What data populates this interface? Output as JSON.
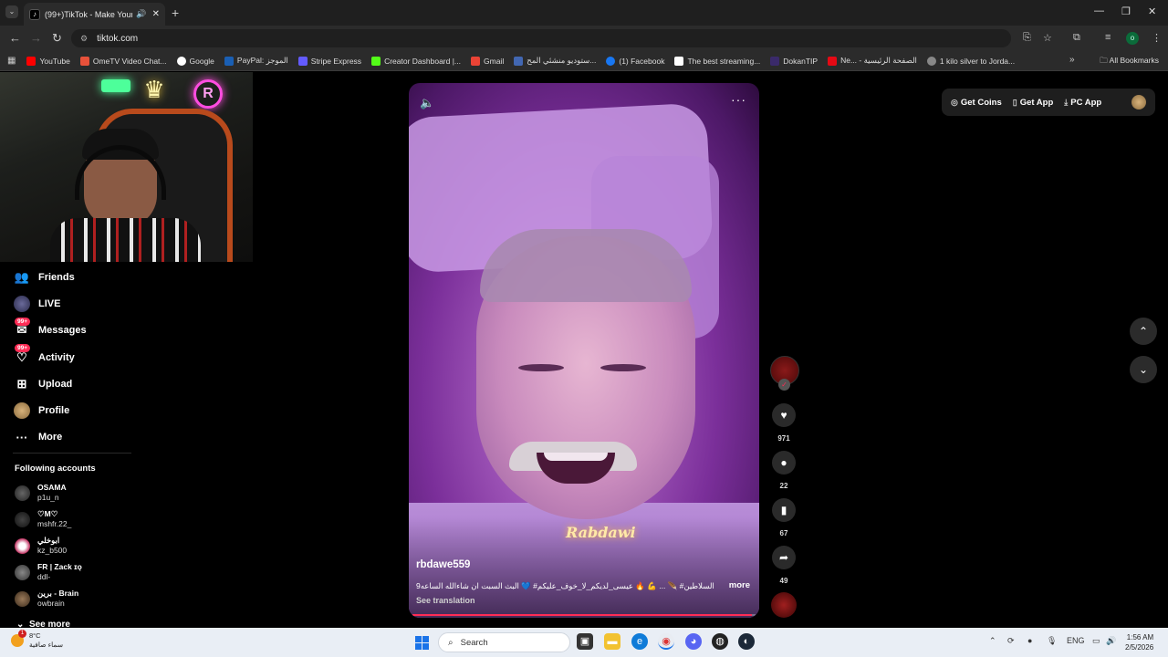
{
  "browser": {
    "tab_title": "(99+)TikTok - Make Your Day",
    "url": "tiktok.com",
    "bookmarks": [
      "YouTube",
      "OmeTV Video Chat...",
      "Google",
      "PayPal: الموجز",
      "Stripe Express",
      "Creator Dashboard |...",
      "Gmail",
      "ستوديو منشئي المح...",
      "(1) Facebook",
      "The best streaming...",
      "DokanTIP",
      "Ne... - الصفحة الرئيسية",
      "1 kilo silver to Jorda..."
    ],
    "all_bookmarks": "All Bookmarks",
    "profile_initial": "o"
  },
  "sidebar": {
    "items": [
      {
        "label": "Friends",
        "icon": "friends-icon"
      },
      {
        "label": "LIVE",
        "icon": "live-icon"
      },
      {
        "label": "Messages",
        "icon": "messages-icon",
        "badge": "99+"
      },
      {
        "label": "Activity",
        "icon": "activity-icon",
        "badge": "99+"
      },
      {
        "label": "Upload",
        "icon": "upload-icon"
      },
      {
        "label": "Profile",
        "icon": "profile-icon"
      },
      {
        "label": "More",
        "icon": "more-icon"
      }
    ],
    "following_header": "Following accounts",
    "accounts": [
      {
        "name": "OSAMA",
        "user": "p1u_n"
      },
      {
        "name": "♡M♡",
        "user": "mshfr.22_"
      },
      {
        "name": "ابوخلي",
        "user": "kz_b500"
      },
      {
        "name": "FR | Zack ɪǫ",
        "user": "ddl-"
      },
      {
        "name": "برين - Brain",
        "user": "owbrain"
      }
    ],
    "see_more": "See more"
  },
  "header_actions": {
    "get_coins": "Get Coins",
    "get_app": "Get App",
    "pc_app": "PC App"
  },
  "video": {
    "username": "rbdawe559",
    "caption": "السلاطين# 🪶 ... 💪 🔥 عيسى_لديكم_لا_خوف_عليكم# 💙 البث السبت ان شاءالله الساعه9",
    "more": "more",
    "see_translation": "See translation",
    "watermark": "Rabdawi",
    "progress": 0.99
  },
  "actions": {
    "likes": "971",
    "comments": "22",
    "saves": "67",
    "shares": "49"
  },
  "taskbar": {
    "temp": "8°C",
    "weather_desc": "سماء صافية",
    "weather_badge": "1",
    "search_label": "Search",
    "lang": "ENG",
    "time": "1:56 AM",
    "date": "2/5/2026"
  },
  "colors": {
    "accent": "#fe2c55",
    "bg": "#000000"
  }
}
